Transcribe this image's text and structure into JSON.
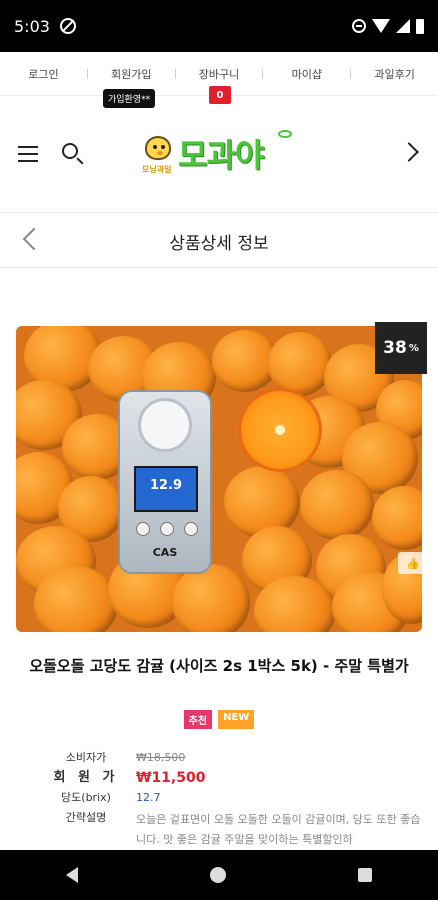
{
  "status": {
    "time": "5:03"
  },
  "top_menu": {
    "items": [
      "로그인",
      "회원가입",
      "장바구니",
      "마이샵",
      "과일후기"
    ],
    "tooltip": "가입환영**",
    "cart_count": "0"
  },
  "header": {
    "logo_main": "모과야",
    "logo_sub": "모닝과일"
  },
  "page": {
    "title": "상품상세 정보"
  },
  "product": {
    "discount": "38",
    "discount_unit": "%",
    "meter_reading": "12.9",
    "meter_brand": "CAS",
    "title": "오돌오돌 고당도 감귤 (사이즈 2s 1박스 5k) - 주말 특별가",
    "badges": [
      "추천",
      "NEW"
    ],
    "info": {
      "consumer_price_label": "소비자가",
      "consumer_price": "₩18,500",
      "member_price_label": "회 원 가",
      "member_price": "₩11,500",
      "brix_label": "당도(brix)",
      "brix": "12.7",
      "desc_label": "간략설명",
      "desc": "오늘은 겉표면이 오돌 오돌한 오돌이 감귤이며, 당도 또한 좋습니다. 맛 좋은 감귤 주말을 맞이하는 특별할인하"
    }
  },
  "colors": {
    "accent_red": "#e2202c",
    "brix_blue": "#2454c6",
    "logo_green": "#4bc63a"
  }
}
